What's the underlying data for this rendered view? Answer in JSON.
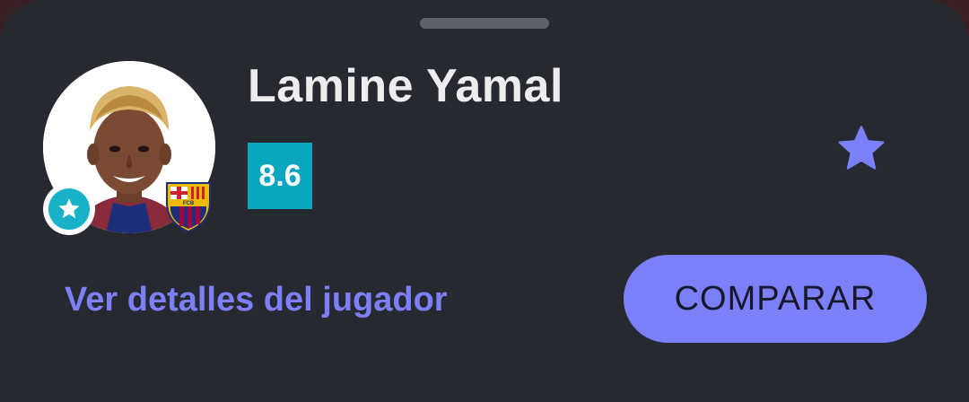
{
  "player": {
    "name": "Lamine Yamal",
    "rating": "8.6",
    "photo_icon": "player-photo",
    "club_icon": "fc-barcelona-crest",
    "club_crest_text": "FCB",
    "badge_icon": "star-icon"
  },
  "actions": {
    "favorite_icon": "star-icon",
    "details_link": "Ver detalles del jugador",
    "compare_label": "COMPARAR"
  },
  "colors": {
    "background": "#262930",
    "accent": "#7b80f8",
    "rating_bg": "#0aa5bf",
    "badge": "#17b2c8",
    "text": "#ededf0"
  }
}
